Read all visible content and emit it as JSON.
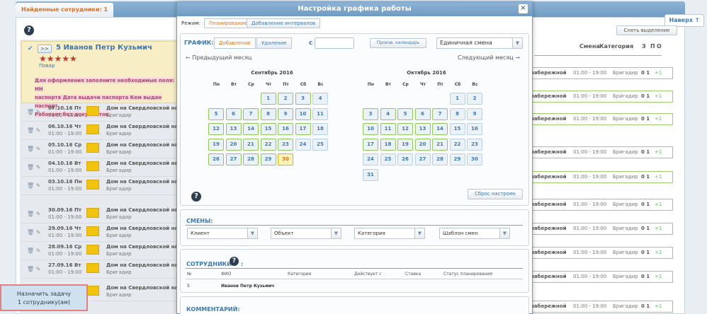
{
  "background": {
    "tab_label": "Найденные сотрудники: 1",
    "to_top": "Наверх ↑",
    "clear_selection": "Снять выделение",
    "headers": {
      "shift": "Смена",
      "category": "Категория",
      "z": "З",
      "p": "П",
      "o": "О"
    },
    "employee": {
      "expand": ">>",
      "name": "5 Иванов Петр Кузьмич",
      "stars": "★★★★★",
      "role": "Повар",
      "warning_lines": [
        "Для оформления заполните необходимые поля: НН",
        "паспорта Дата выдачи паспорта Кем выдан паспорт",
        "Работает без документов."
      ]
    },
    "shift_rows": [
      {
        "date": "07.10.16 Пт",
        "time": "01:00 - 19:00",
        "place": "Дом на Свердловской набе",
        "role": "Бригадир"
      },
      {
        "date": "06.10.16 Чт",
        "time": "01:00 - 19:00",
        "place": "Дом на Свердловской набе",
        "role": "Бригадир"
      },
      {
        "date": "05.10.16 Ср",
        "time": "01:00 - 19:00",
        "place": "Дом на Свердловской набе",
        "role": "Бригадир"
      },
      {
        "date": "04.10.16 Вт",
        "time": "01:00 - 19:00",
        "place": "Дом на Свердловской набе",
        "role": "Бригадир"
      },
      {
        "date": "03.10.16 Пн",
        "time": "01:00 - 19:00",
        "place": "Дом на Свердловской набе",
        "role": "Бригадир"
      },
      {
        "date": "30.09.16 Пт",
        "time": "01:00 - 19:00",
        "place": "Дом на Свердловской набе",
        "role": "Бригадир"
      },
      {
        "date": "29.09.16 Чт",
        "time": "01:00 - 19:00",
        "place": "Дом на Свердловской набе",
        "role": "Бригадир"
      },
      {
        "date": "28.09.16 Ср",
        "time": "01:00 - 19:00",
        "place": "Дом на Свердловской набе",
        "role": "Бригадир"
      },
      {
        "date": "27.09.16 Вт",
        "time": "01:00 - 19:00",
        "place": "Дом на Свердловской набе",
        "role": "Бригадир"
      },
      {
        "date": "",
        "time": "",
        "place": "Дом на Свердловской набе",
        "role": "Бригадир"
      }
    ],
    "right_row": {
      "place": "набережной",
      "time": "01:00 - 19:00",
      "role": "Бригадир",
      "count": "0 1",
      "plus": "+1"
    },
    "assign_line1": "Назначить задачу",
    "assign_line2": "1 сотруднику(ам)"
  },
  "modal": {
    "title": "Настройка графика работы",
    "close": "×",
    "mode_label": "Режим:",
    "mode_tabs": [
      "Планирование",
      "Добавление интервалов"
    ],
    "schedule_label": "ГРАФИК:",
    "segment": [
      "Добавление",
      "Удаление"
    ],
    "from_label": "с",
    "prod_calendar": "Произв. календарь",
    "shift_type": "Единичная смена",
    "prev_month": "Предыдущий месяц",
    "next_month": "Следующий месяц",
    "reset": "Сброс настроек",
    "dow": [
      "Пн",
      "Вт",
      "Ср",
      "Чт",
      "Пт",
      "Сб",
      "Вс"
    ],
    "calendars": [
      {
        "title": "Сентябрь 2016",
        "weeks": [
          [
            "",
            "",
            "",
            "1",
            "2",
            "3",
            "4"
          ],
          [
            "5",
            "6",
            "7",
            "8",
            "9",
            "10",
            "11"
          ],
          [
            "12",
            "13",
            "14",
            "15",
            "16",
            "17",
            "18"
          ],
          [
            "19",
            "20",
            "21",
            "22",
            "23",
            "24",
            "25"
          ],
          [
            "26",
            "27",
            "28",
            "29",
            "30",
            "",
            ""
          ]
        ]
      },
      {
        "title": "Октябрь 2016",
        "weeks": [
          [
            "",
            "",
            "",
            "",
            "",
            "1",
            "2"
          ],
          [
            "3",
            "4",
            "5",
            "6",
            "7",
            "8",
            "9"
          ],
          [
            "10",
            "11",
            "12",
            "13",
            "14",
            "15",
            "16"
          ],
          [
            "17",
            "18",
            "19",
            "20",
            "21",
            "22",
            "23"
          ],
          [
            "24",
            "25",
            "26",
            "27",
            "28",
            "29",
            "30"
          ],
          [
            "31",
            "",
            "",
            "",
            "",
            "",
            ""
          ]
        ]
      }
    ],
    "shifts_title": "СМЕНЫ:",
    "filters": [
      "Клиент",
      "Объект",
      "Категория",
      "Шаблон смен"
    ],
    "employees_title": "СОТРУДНИКИ",
    "employees_colon": ":",
    "emp_headers": [
      "№",
      "ФИО",
      "Категория",
      "Действует с",
      "Ставка",
      "Статус планирования"
    ],
    "emp_row": [
      "5",
      "Иванов Петр Кузьмич"
    ],
    "comment_title": "КОММЕНТАРИЙ:"
  }
}
